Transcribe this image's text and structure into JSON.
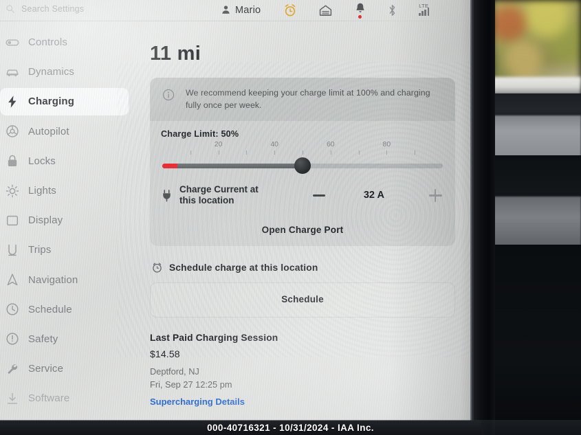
{
  "topbar": {
    "search_placeholder": "Search Settings",
    "search_icon": "search-icon",
    "user_name": "Mario",
    "user_icon": "person-icon",
    "alarm_icon": "alarm-clock-icon",
    "garage_icon": "garage-icon",
    "bell_icon": "bell-icon",
    "bluetooth_icon": "bluetooth-icon",
    "signal_label": "LTE",
    "signal_icon": "cellular-bars-icon",
    "alarm_color": "#e3a72c",
    "bell_dot_color": "#e0342a"
  },
  "sidebar": {
    "items": [
      {
        "label": "Controls",
        "icon": "toggle-icon",
        "active": false,
        "dim": false
      },
      {
        "label": "Dynamics",
        "icon": "car-icon",
        "active": false,
        "dim": false
      },
      {
        "label": "Charging",
        "icon": "lightning-bolt-icon",
        "active": true,
        "dim": false
      },
      {
        "label": "Autopilot",
        "icon": "steering-wheel-icon",
        "active": false,
        "dim": false
      },
      {
        "label": "Locks",
        "icon": "lock-icon",
        "active": false,
        "dim": false
      },
      {
        "label": "Lights",
        "icon": "light-bulb-icon",
        "active": false,
        "dim": false
      },
      {
        "label": "Display",
        "icon": "display-icon",
        "active": false,
        "dim": false
      },
      {
        "label": "Trips",
        "icon": "trips-icon",
        "active": false,
        "dim": false
      },
      {
        "label": "Navigation",
        "icon": "navigation-arrow-icon",
        "active": false,
        "dim": false
      },
      {
        "label": "Schedule",
        "icon": "clock-icon",
        "active": false,
        "dim": false
      },
      {
        "label": "Safety",
        "icon": "shield-icon",
        "active": false,
        "dim": false
      },
      {
        "label": "Service",
        "icon": "wrench-icon",
        "active": false,
        "dim": false
      },
      {
        "label": "Software",
        "icon": "download-icon",
        "active": false,
        "dim": true
      }
    ]
  },
  "main": {
    "range": "11 mi",
    "banner": {
      "icon": "info-icon",
      "text": "We recommend keeping your charge limit at 100% and charging fully once per week."
    },
    "charge_limit": {
      "label": "Charge Limit: 50%",
      "value_percent": 50,
      "red_zone_percent": 5,
      "ticks_major": [
        20,
        40,
        60,
        80
      ],
      "ticks_minor": [
        10,
        20,
        30,
        40,
        50,
        60,
        70,
        80,
        90
      ],
      "min": 0,
      "max": 100,
      "red_color": "#ec1c23",
      "knob_color": "#1c1e20"
    },
    "charge_current": {
      "icon": "plug-icon",
      "label": "Charge Current at this location",
      "minus_label": "—",
      "value": "32",
      "unit": "A",
      "value_display": "32 A",
      "plus_label": "+",
      "plus_enabled": false
    },
    "open_charge_port": "Open Charge Port",
    "schedule_link": {
      "icon": "alarm-clock-icon",
      "text": "Schedule charge at this location"
    },
    "schedule_button": "Schedule",
    "last_paid_session": {
      "title": "Last Paid Charging Session",
      "amount": "$14.58",
      "location": "Deptford, NJ",
      "datetime": "Fri, Sep 27 12:25 pm",
      "details_link": "Supercharging Details"
    }
  },
  "watermark": {
    "text": "000-40716321 - 10/31/2024 - IAA Inc."
  }
}
